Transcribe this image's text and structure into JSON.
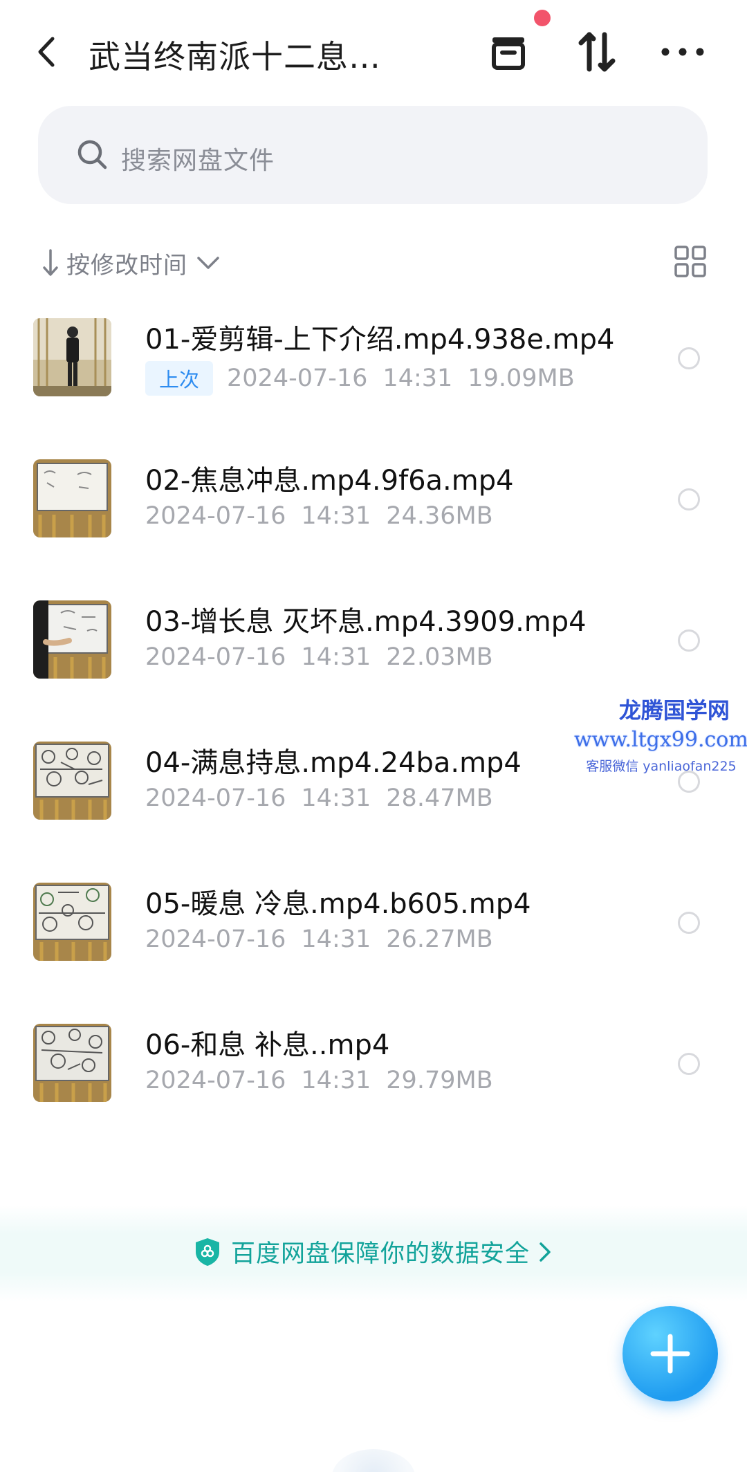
{
  "header": {
    "title": "武当终南派十二息…",
    "icons": [
      "back-icon",
      "archive-icon",
      "transfer-icon",
      "more-icon"
    ],
    "notification_dot_color": "#f2546b"
  },
  "search": {
    "placeholder": "搜索网盘文件"
  },
  "sort": {
    "label": "按修改时间"
  },
  "files": [
    {
      "name": "01-爱剪辑-上下介绍.mp4.938e.mp4",
      "badge": "上次",
      "date": "2024-07-16",
      "time": "14:31",
      "size": "19.09MB"
    },
    {
      "name": "02-焦息冲息.mp4.9f6a.mp4",
      "badge": "",
      "date": "2024-07-16",
      "time": "14:31",
      "size": "24.36MB"
    },
    {
      "name": "03-增长息 灭坏息.mp4.3909.mp4",
      "badge": "",
      "date": "2024-07-16",
      "time": "14:31",
      "size": "22.03MB"
    },
    {
      "name": "04-满息持息.mp4.24ba.mp4",
      "badge": "",
      "date": "2024-07-16",
      "time": "14:31",
      "size": "28.47MB"
    },
    {
      "name": "05-暖息  冷息.mp4.b605.mp4",
      "badge": "",
      "date": "2024-07-16",
      "time": "14:31",
      "size": "26.27MB"
    },
    {
      "name": "06-和息 补息..mp4",
      "badge": "",
      "date": "2024-07-16",
      "time": "14:31",
      "size": "29.79MB"
    }
  ],
  "watermark": {
    "line1": "龙腾国学网",
    "line2": "www.ltgx99.com",
    "line3": "客服微信 yanliaofan225"
  },
  "banner": {
    "text": "百度网盘保障你的数据安全"
  },
  "colors": {
    "accent": "#2d8cf0",
    "safety": "#12a39a",
    "fab": "#1f9cf0"
  }
}
